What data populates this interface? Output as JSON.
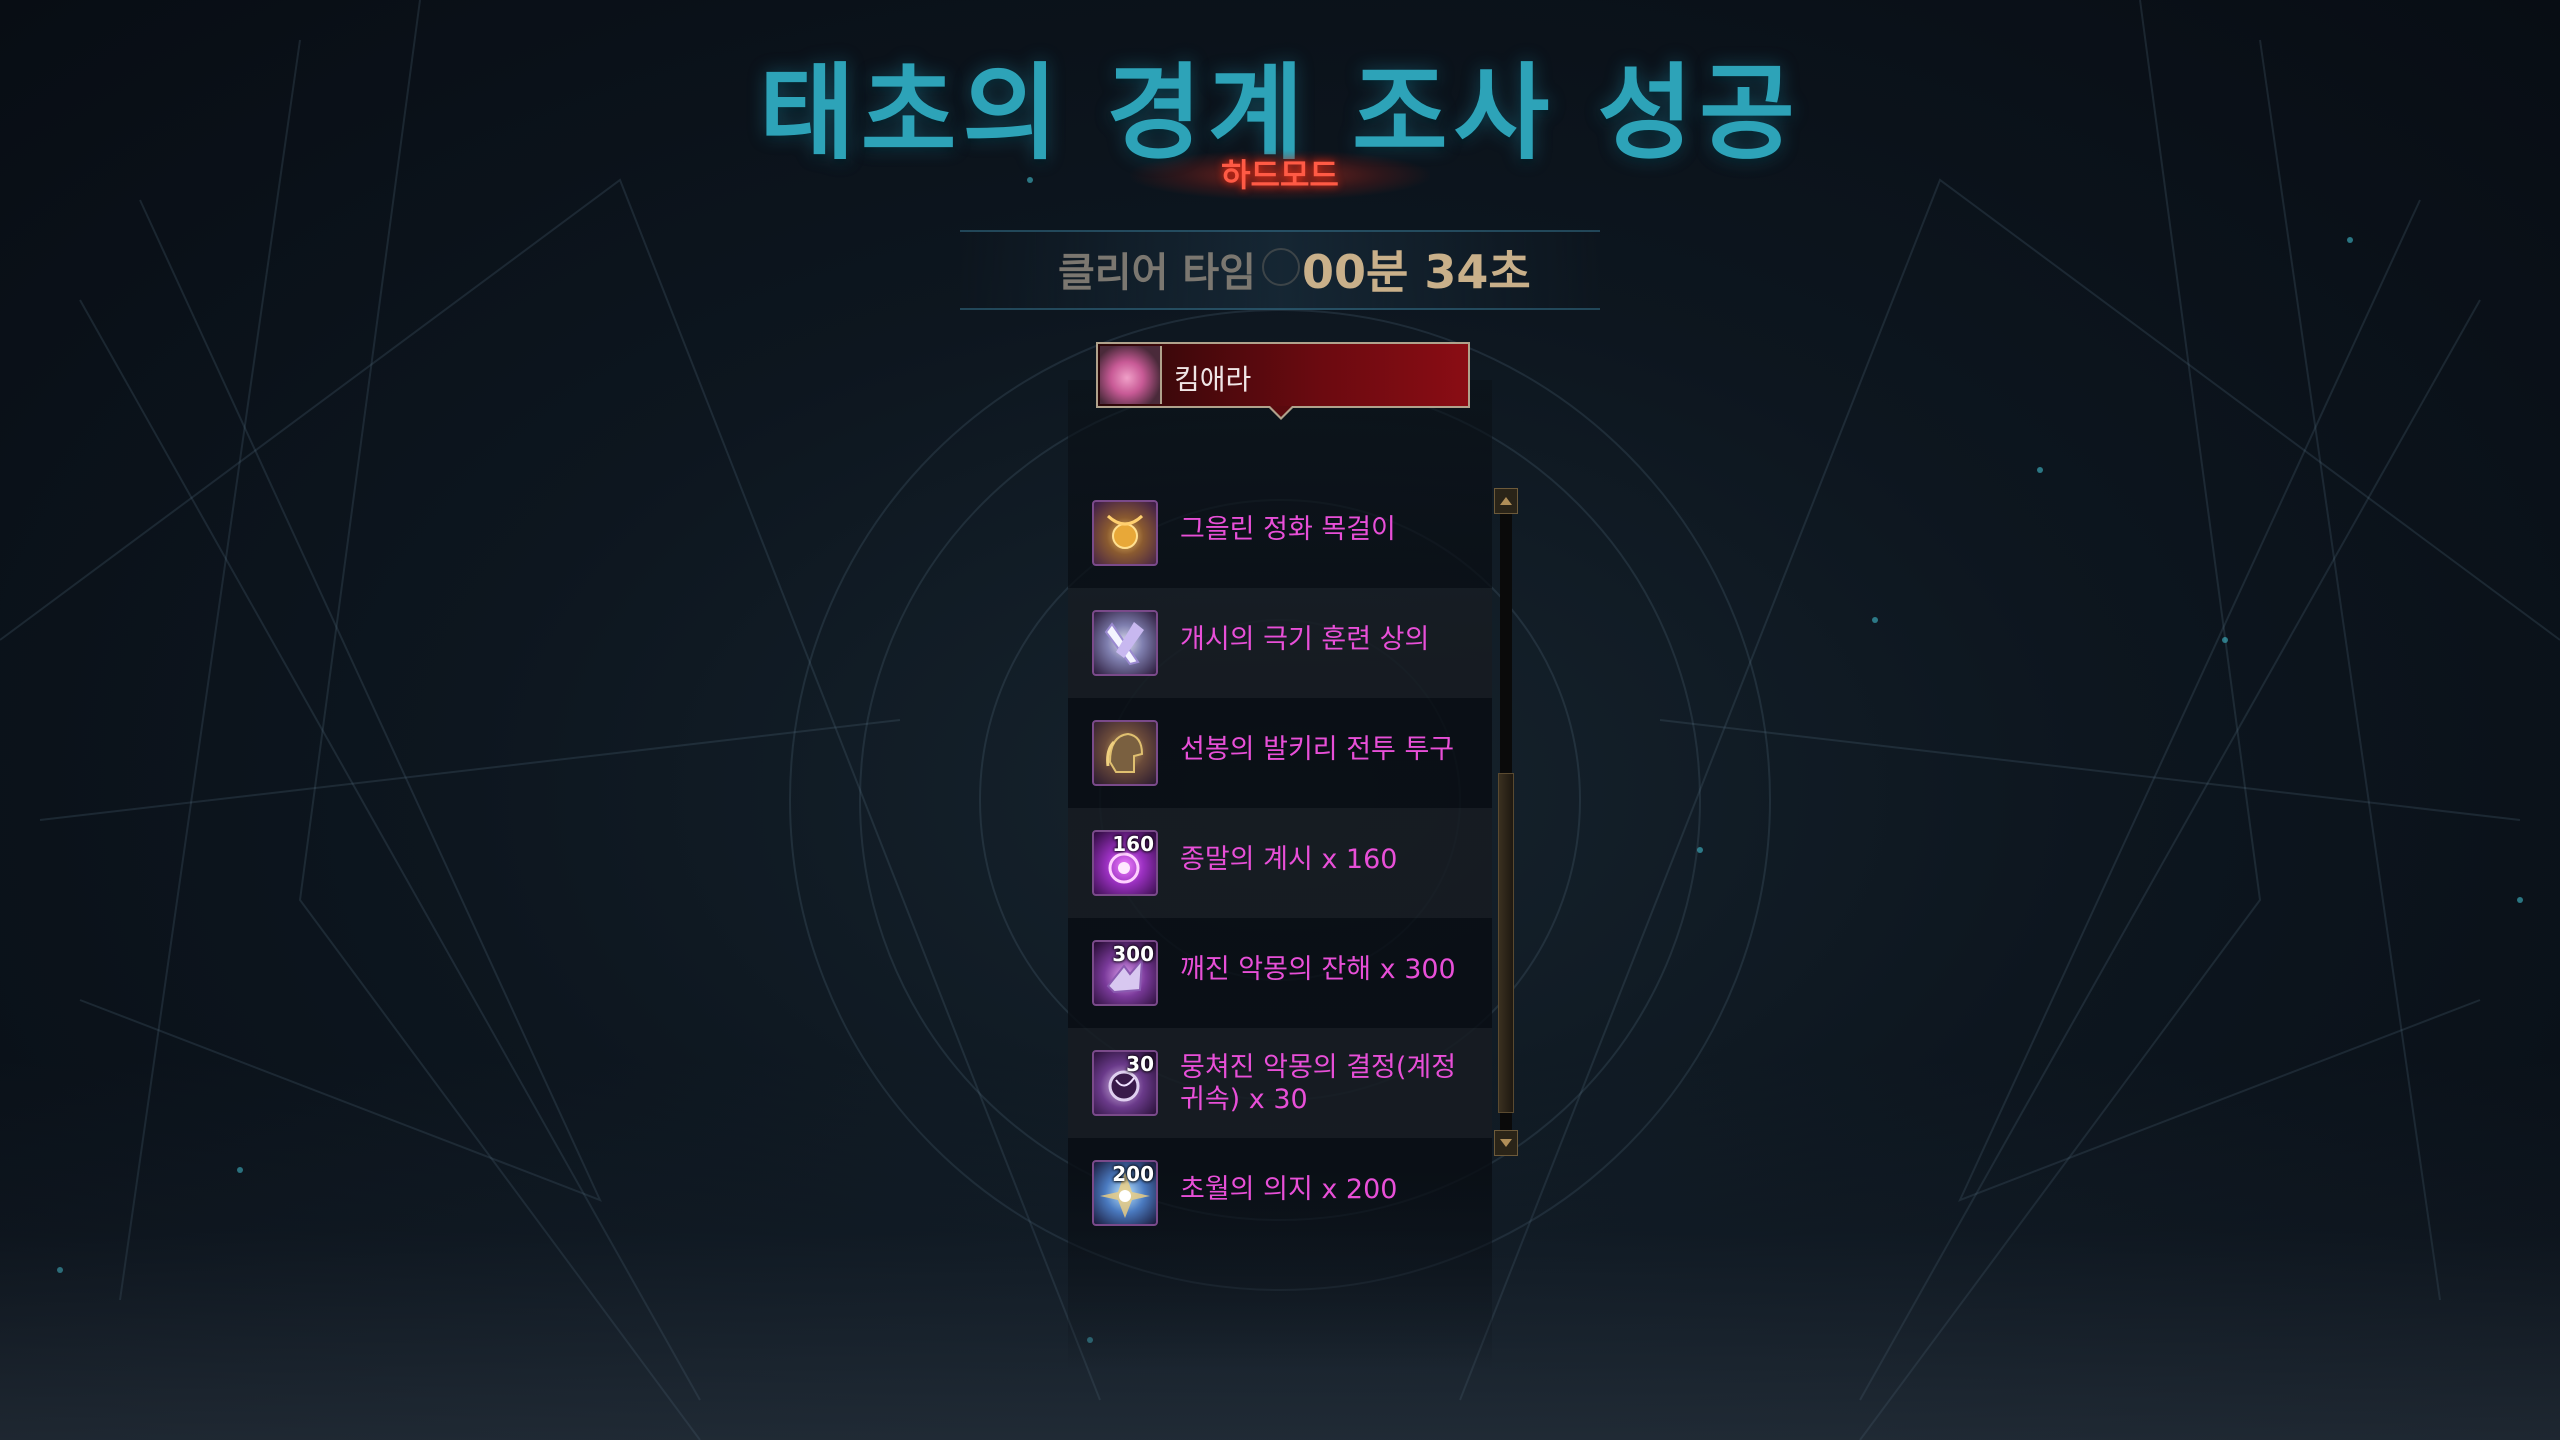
{
  "header": {
    "title": "태초의 경계 조사 성공",
    "mode": "하드모드"
  },
  "clear": {
    "label": "클리어 타임",
    "value": "00분 34초"
  },
  "player": {
    "name": "킴애라"
  },
  "rewards": [
    {
      "name": "그을린 정화 목걸이",
      "qty": "",
      "icon": "necklace-icon"
    },
    {
      "name": "개시의 극기 훈련 상의",
      "qty": "",
      "icon": "top-armor-icon"
    },
    {
      "name": "선봉의 발키리 전투 투구",
      "qty": "",
      "icon": "helmet-icon"
    },
    {
      "name": "종말의 계시 x 160",
      "qty": "160",
      "icon": "revelation-orb-icon"
    },
    {
      "name": "깨진 악몽의 잔해 x 300",
      "qty": "300",
      "icon": "nightmare-debris-icon"
    },
    {
      "name": "뭉쳐진 악몽의 결정(계정 귀속) x 30",
      "qty": "30",
      "icon": "nightmare-crystal-icon"
    },
    {
      "name": "초월의 의지 x 200",
      "qty": "200",
      "icon": "transcendence-will-icon"
    }
  ],
  "colors": {
    "title": "#2da3b8",
    "mode": "#ff5a45",
    "item_text": "#e84fd8",
    "player_bar": "#6b0a10"
  }
}
